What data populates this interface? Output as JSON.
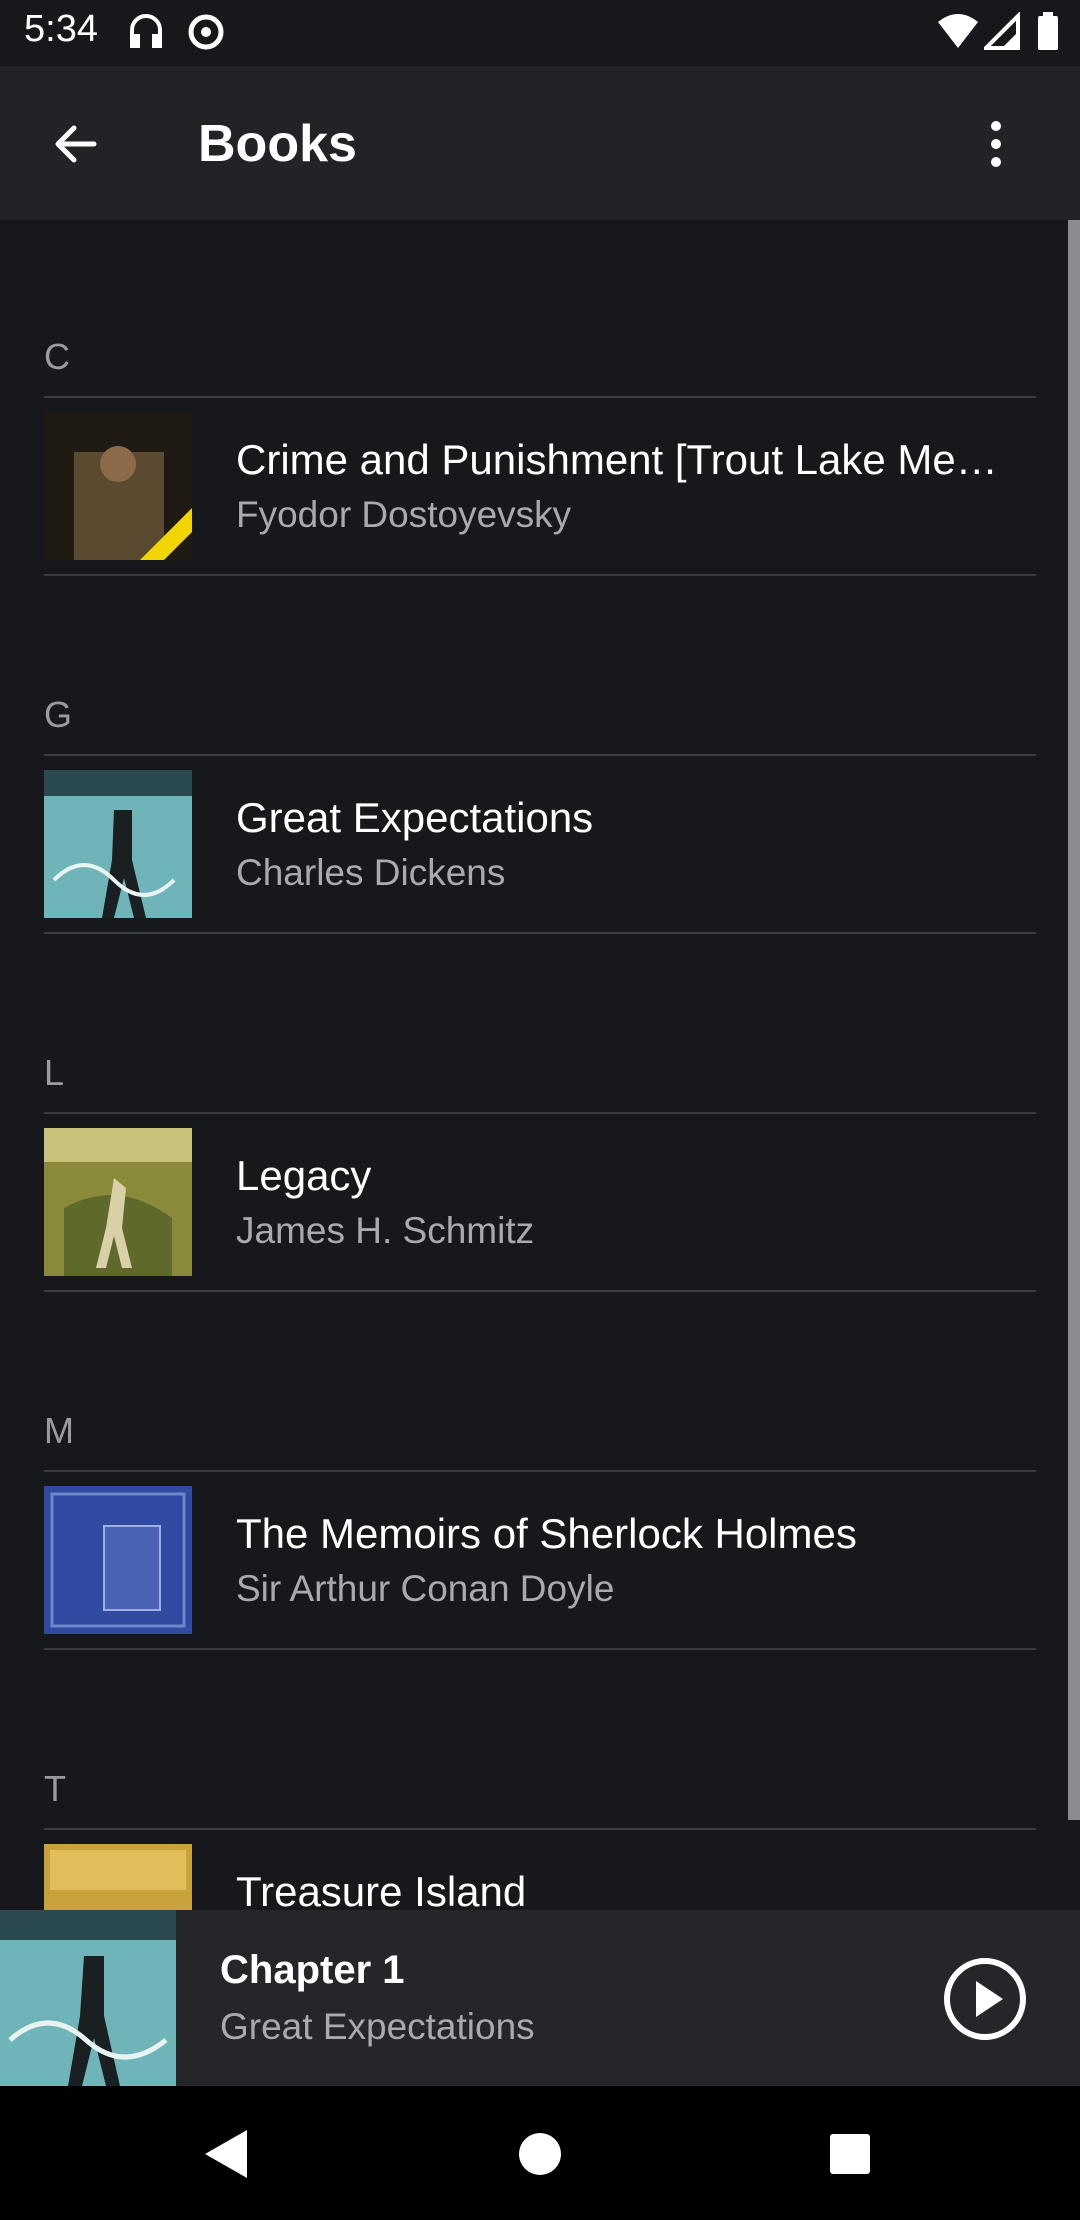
{
  "status_bar": {
    "time": "5:34"
  },
  "app_bar": {
    "title": "Books"
  },
  "sections": [
    {
      "letter": "C",
      "books": [
        {
          "title": "Crime and Punishment [Trout Lake Me…",
          "author": "Fyodor Dostoyevsky"
        }
      ]
    },
    {
      "letter": "G",
      "books": [
        {
          "title": "Great Expectations",
          "author": "Charles Dickens"
        }
      ]
    },
    {
      "letter": "L",
      "books": [
        {
          "title": "Legacy",
          "author": "James H. Schmitz"
        }
      ]
    },
    {
      "letter": "M",
      "books": [
        {
          "title": "The Memoirs of Sherlock Holmes",
          "author": "Sir Arthur Conan Doyle"
        }
      ]
    },
    {
      "letter": "T",
      "books": [
        {
          "title": "Treasure Island",
          "author": ""
        }
      ]
    }
  ],
  "now_playing": {
    "title": "Chapter 1",
    "subtitle": "Great Expectations"
  },
  "icons": {
    "back": "arrow-left-icon",
    "menu": "more-vert-icon",
    "play": "play-circle-icon",
    "nav_back": "triangle-back-icon",
    "nav_home": "circle-home-icon",
    "nav_recents": "square-recents-icon"
  },
  "colors": {
    "background": "#17181c",
    "app_bar": "#222327",
    "now_playing_bar": "#25262a",
    "secondary_text": "#a9aaae"
  }
}
